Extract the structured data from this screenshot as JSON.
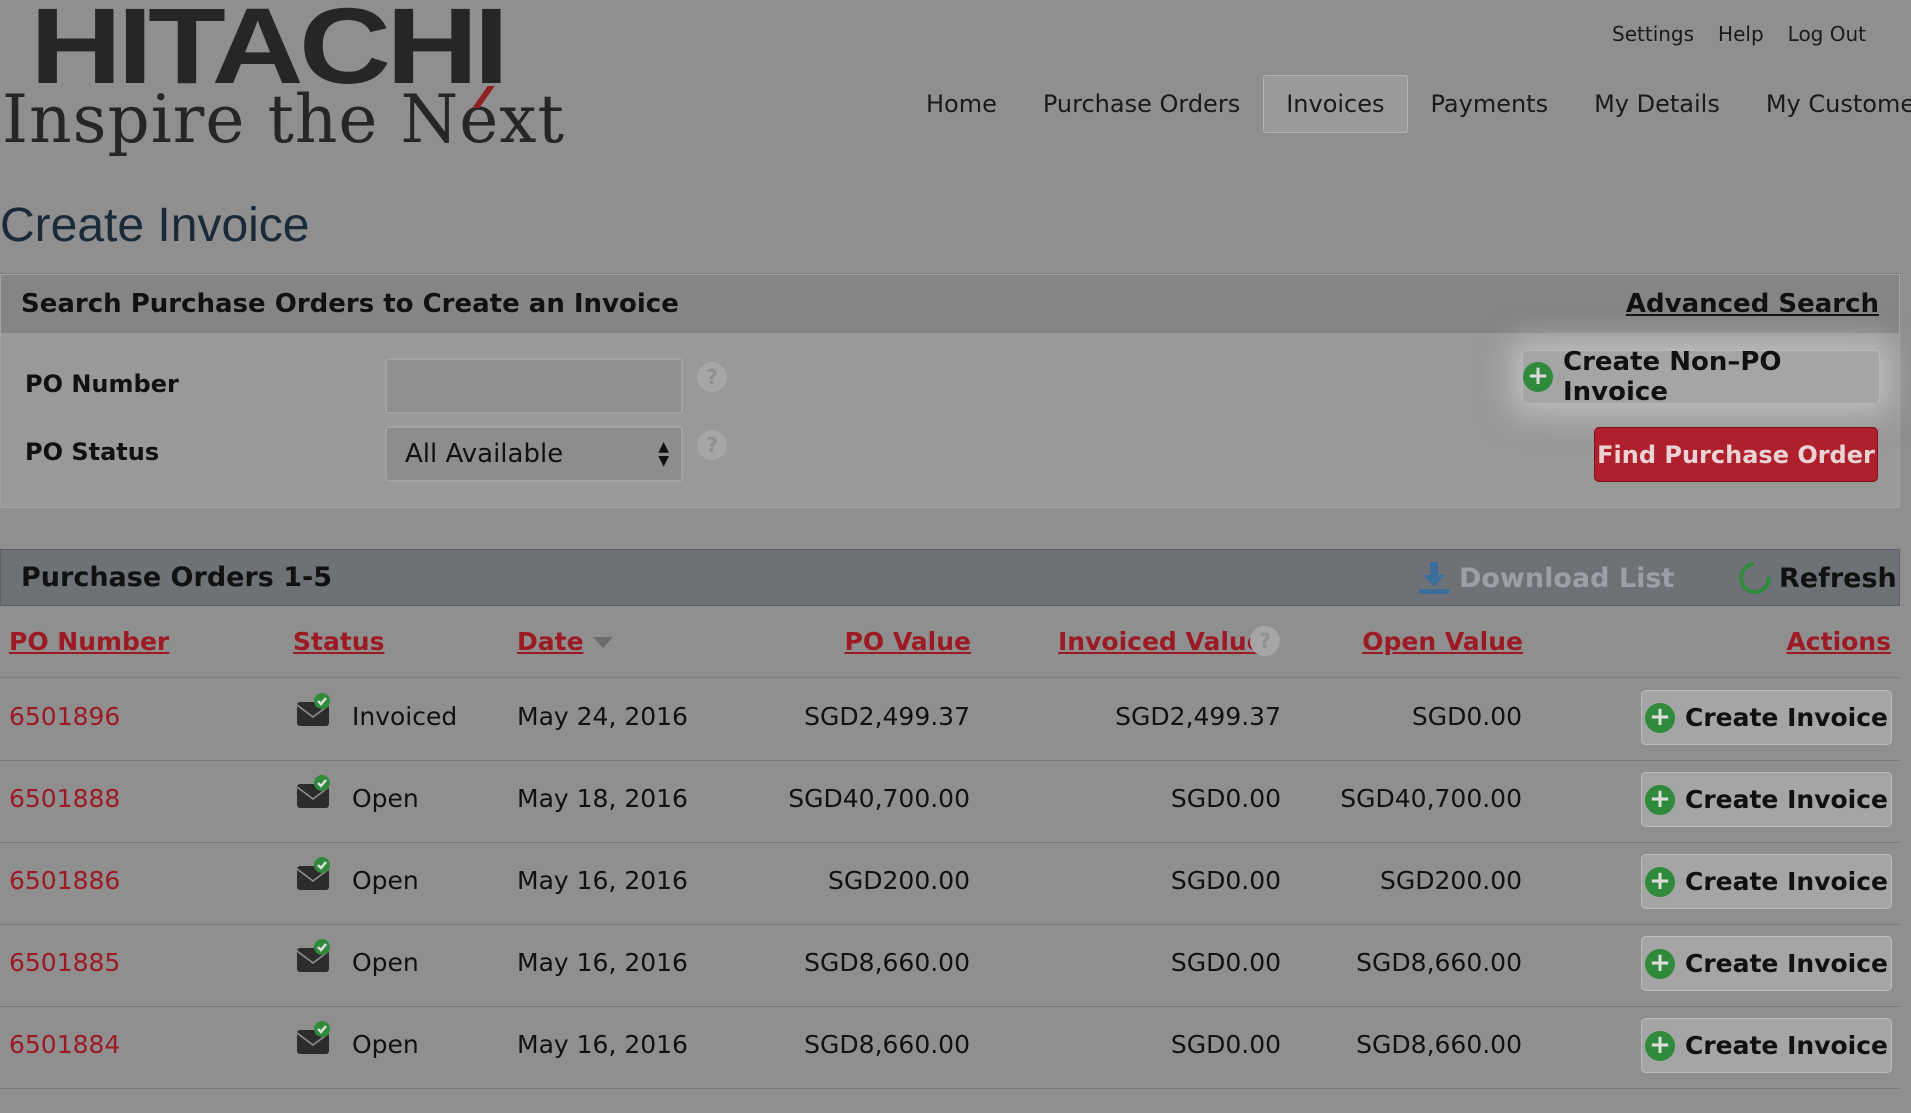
{
  "brand": {
    "logo_word": "HITACHI",
    "tagline": "Inspire the Next"
  },
  "header": {
    "util_links": [
      "Settings",
      "Help",
      "Log Out"
    ],
    "nav": [
      "Home",
      "Purchase Orders",
      "Invoices",
      "Payments",
      "My Details",
      "My Customer"
    ],
    "active_nav": "Invoices"
  },
  "page": {
    "title": "Create Invoice"
  },
  "search": {
    "title": "Search Purchase Orders to Create an Invoice",
    "advanced_link": "Advanced Search",
    "po_number_label": "PO Number",
    "po_number_value": "",
    "po_status_label": "PO Status",
    "po_status_value": "All Available",
    "non_po_button": "Create Non–PO Invoice",
    "find_button": "Find Purchase Order",
    "help_glyph": "?"
  },
  "results": {
    "title": "Purchase Orders 1-5",
    "download_label": "Download List",
    "refresh_label": "Refresh",
    "columns": {
      "po_number": "PO Number",
      "status": "Status",
      "date": "Date",
      "po_value": "PO Value",
      "invoiced_value": "Invoiced Value",
      "open_value": "Open Value",
      "actions": "Actions"
    },
    "action_label": "Create Invoice",
    "rows": [
      {
        "po": "6501896",
        "status": "Invoiced",
        "date": "May 24, 2016",
        "po_value": "SGD2,499.37",
        "invoiced_value": "SGD2,499.37",
        "open_value": "SGD0.00"
      },
      {
        "po": "6501888",
        "status": "Open",
        "date": "May 18, 2016",
        "po_value": "SGD40,700.00",
        "invoiced_value": "SGD0.00",
        "open_value": "SGD40,700.00"
      },
      {
        "po": "6501886",
        "status": "Open",
        "date": "May 16, 2016",
        "po_value": "SGD200.00",
        "invoiced_value": "SGD0.00",
        "open_value": "SGD200.00"
      },
      {
        "po": "6501885",
        "status": "Open",
        "date": "May 16, 2016",
        "po_value": "SGD8,660.00",
        "invoiced_value": "SGD0.00",
        "open_value": "SGD8,660.00"
      },
      {
        "po": "6501884",
        "status": "Open",
        "date": "May 16, 2016",
        "po_value": "SGD8,660.00",
        "invoiced_value": "SGD0.00",
        "open_value": "SGD8,660.00"
      }
    ]
  },
  "colors": {
    "background": "#8f8f8f",
    "link_red": "#9c1a24",
    "primary_button": "#b0202c",
    "success_green": "#2f8a3b"
  },
  "icons": {
    "plus": "plus-circle-icon",
    "status": "envelope-check-icon",
    "download": "download-icon",
    "refresh": "refresh-icon",
    "help": "help-icon",
    "sort": "sort-desc-icon"
  }
}
